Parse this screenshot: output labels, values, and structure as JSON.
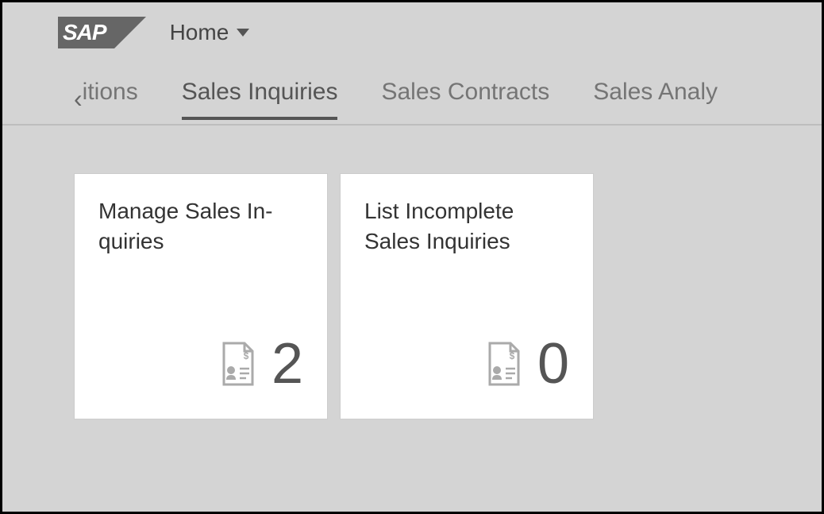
{
  "header": {
    "logo_text": "SAP",
    "home_label": "Home"
  },
  "tabs": {
    "partial_left": "itions",
    "items": [
      {
        "label": "Sales Inquiries",
        "active": true
      },
      {
        "label": "Sales Contracts",
        "active": false
      },
      {
        "label": "Sales Analy",
        "active": false
      }
    ]
  },
  "tiles": [
    {
      "title": "Manage Sales In-",
      "title_line2": "quiries",
      "count": "2"
    },
    {
      "title": "List Incomplete",
      "title_line2": "Sales Inquiries",
      "count": "0"
    }
  ]
}
